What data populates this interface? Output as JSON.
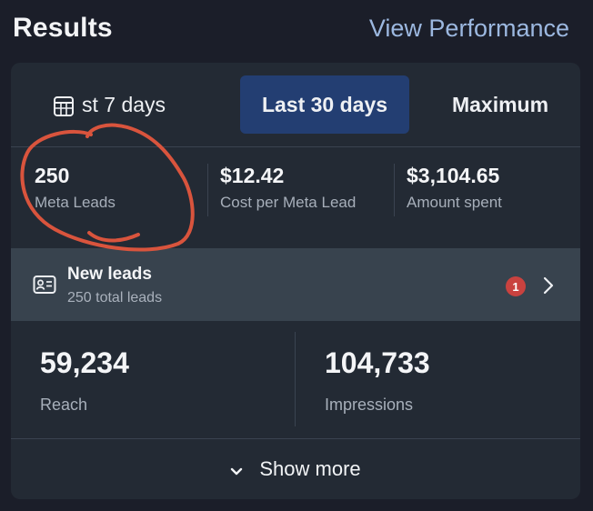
{
  "header": {
    "title": "Results",
    "link": "View Performance"
  },
  "tabs": {
    "icon": "calendar-table-icon",
    "items": [
      {
        "label": "st 7 days",
        "selected": false
      },
      {
        "label": "Last 30 days",
        "selected": true
      },
      {
        "label": "Maximum",
        "selected": false
      }
    ]
  },
  "metrics": [
    {
      "value": "250",
      "label": "Meta Leads"
    },
    {
      "value": "$12.42",
      "label": "Cost per Meta Lead"
    },
    {
      "value": "$3,104.65",
      "label": "Amount spent"
    }
  ],
  "leads": {
    "icon": "contact-card-icon",
    "title": "New leads",
    "subtitle": "250 total leads",
    "badge": "1",
    "chevron_icon": "chevron-right-icon"
  },
  "stats": [
    {
      "value": "59,234",
      "label": "Reach"
    },
    {
      "value": "104,733",
      "label": "Impressions"
    }
  ],
  "show_more": {
    "label": "Show more",
    "icon": "chevron-down-icon"
  },
  "colors": {
    "background": "#1b1e29",
    "card": "#232a34",
    "selected_tab": "#233e72",
    "leads_row": "#38434e",
    "link": "#9cb8e0",
    "badge": "#c9423f",
    "annotation": "#d9543d"
  }
}
